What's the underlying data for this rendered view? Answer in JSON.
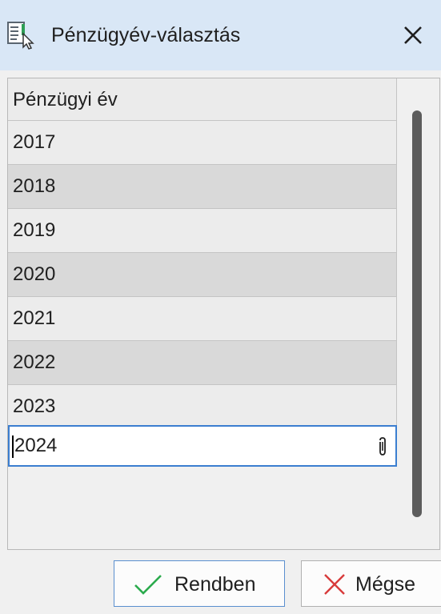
{
  "window": {
    "title": "Pénzügyév-választás",
    "colors": {
      "titlebar": "#d9e7f6",
      "selection": "#3b7ed0",
      "ok_check": "#2bab4d",
      "cancel_x": "#d83b3b"
    }
  },
  "grid": {
    "column_header": "Pénzügyi év",
    "rows": [
      {
        "value": "2017"
      },
      {
        "value": "2018"
      },
      {
        "value": "2019"
      },
      {
        "value": "2020"
      },
      {
        "value": "2021"
      },
      {
        "value": "2022"
      },
      {
        "value": "2023"
      },
      {
        "value": "2024"
      }
    ],
    "editing_row_icon": "paperclip-icon"
  },
  "buttons": {
    "ok_label": "Rendben",
    "ok_icon": "checkmark-icon",
    "cancel_label": "Mégse",
    "cancel_icon": "x-icon"
  }
}
